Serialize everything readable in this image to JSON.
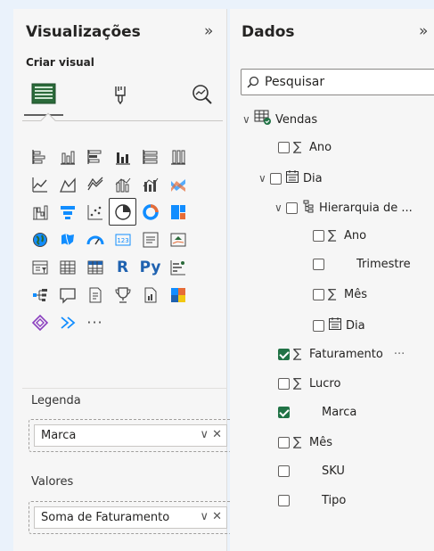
{
  "viz_panel": {
    "title": "Visualizações",
    "collapse_glyph": "»",
    "subheader": "Criar visual",
    "more_glyph": "···",
    "r_label": "R",
    "py_label": "Py"
  },
  "data_panel": {
    "title": "Dados",
    "collapse_glyph": "»",
    "search_placeholder": "Pesquisar"
  },
  "wells": {
    "legend_label": "Legenda",
    "legend_field": "Marca",
    "values_label": "Valores",
    "values_field": "Soma de Faturamento",
    "chip_actions": "∨ ✕"
  },
  "tree": {
    "table": "Vendas",
    "ano": "Ano",
    "dia": "Dia",
    "hierarquia": "Hierarquia de ...",
    "h_ano": "Ano",
    "h_trimestre": "Trimestre",
    "h_mes": "Mês",
    "h_dia": "Dia",
    "faturamento": "Faturamento",
    "faturamento_more": "···",
    "lucro": "Lucro",
    "marca": "Marca",
    "mes": "Mês",
    "sku": "SKU",
    "tipo": "Tipo"
  },
  "colors": {
    "accent_blue": "#1f62b0",
    "check_green": "#217346",
    "teal": "#118dff",
    "orange": "#e66c37"
  }
}
